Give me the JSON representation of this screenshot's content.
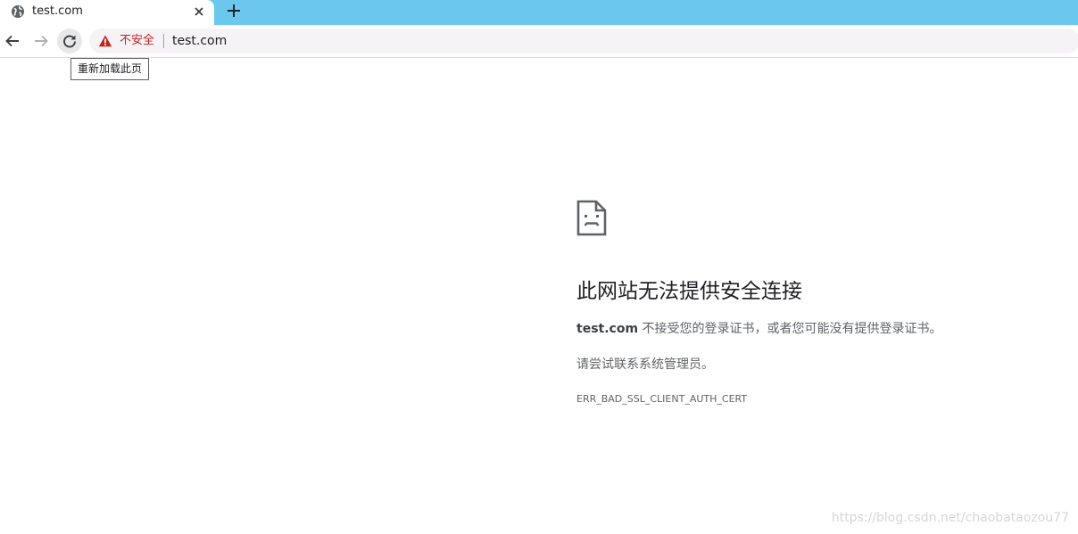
{
  "tab": {
    "title": "test.com",
    "favicon": "globe-icon",
    "close_icon": "close-icon"
  },
  "tabstrip": {
    "new_tab_icon": "plus-icon",
    "color": "#6ac8ef"
  },
  "toolbar": {
    "back_icon": "arrow-left-icon",
    "forward_icon": "arrow-right-icon",
    "reload_icon": "reload-icon"
  },
  "omnibox": {
    "security_icon": "warning-triangle-icon",
    "security_label": "不安全",
    "security_color": "#c5221f",
    "url": "test.com"
  },
  "tooltip": {
    "text": "重新加载此页"
  },
  "error": {
    "icon": "sad-document-icon",
    "heading": "此网站无法提供安全连接",
    "desc_host": "test.com",
    "desc_rest": " 不接受您的登录证书，或者您可能没有提供登录证书。",
    "suggestion": "请尝试联系系统管理员。",
    "code": "ERR_BAD_SSL_CLIENT_AUTH_CERT"
  },
  "watermark": "https://blog.csdn.net/chaobataozou77"
}
